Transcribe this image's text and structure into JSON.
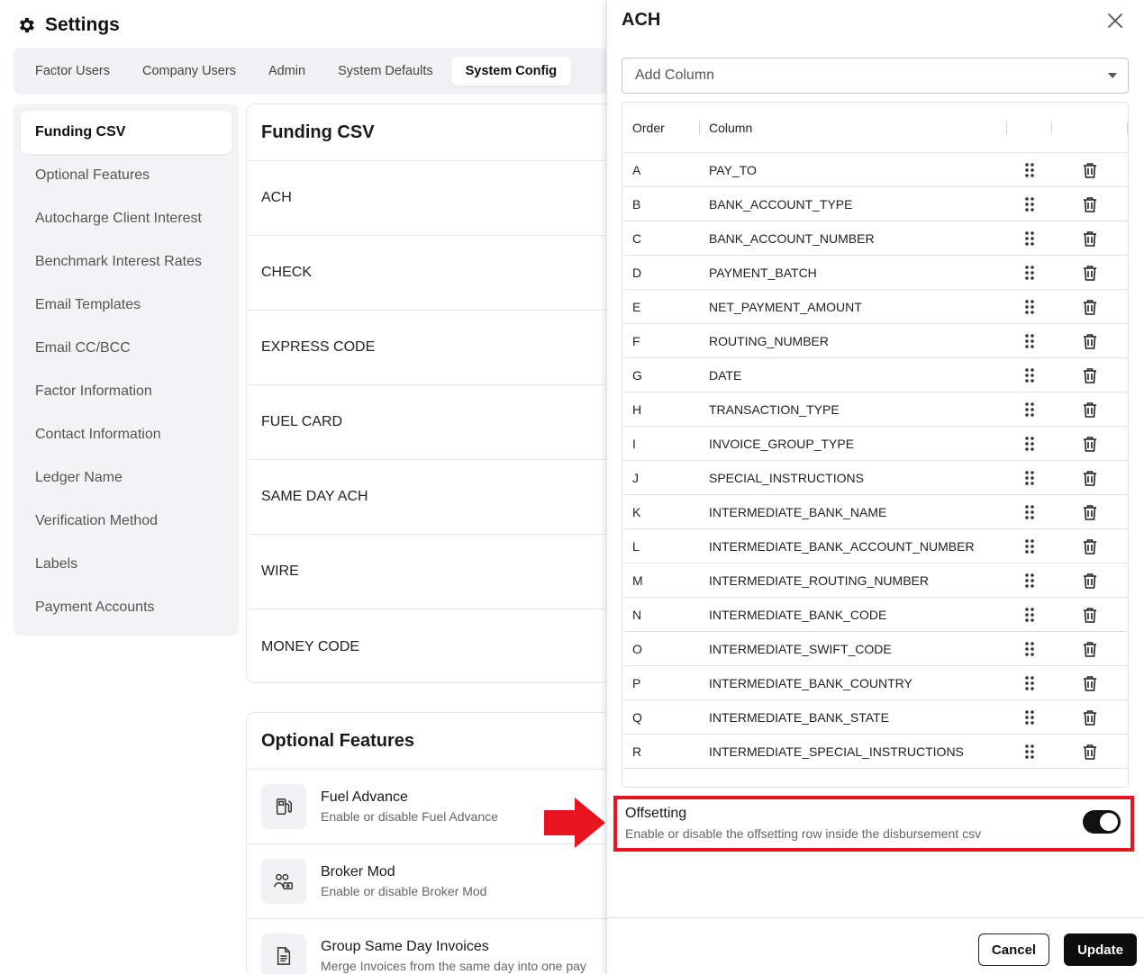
{
  "header": {
    "title": "Settings"
  },
  "tabs": [
    {
      "label": "Factor Users"
    },
    {
      "label": "Company Users"
    },
    {
      "label": "Admin"
    },
    {
      "label": "System Defaults"
    },
    {
      "label": "System Config"
    }
  ],
  "sidebar": {
    "items": [
      {
        "label": "Funding CSV"
      },
      {
        "label": "Optional Features"
      },
      {
        "label": "Autocharge Client Interest"
      },
      {
        "label": "Benchmark Interest Rates"
      },
      {
        "label": "Email Templates"
      },
      {
        "label": "Email CC/BCC"
      },
      {
        "label": "Factor Information"
      },
      {
        "label": "Contact Information"
      },
      {
        "label": "Ledger Name"
      },
      {
        "label": "Verification Method"
      },
      {
        "label": "Labels"
      },
      {
        "label": "Payment Accounts"
      }
    ]
  },
  "funding_csv": {
    "title": "Funding CSV",
    "rows": [
      "ACH",
      "CHECK",
      "EXPRESS CODE",
      "FUEL CARD",
      "SAME DAY ACH",
      "WIRE",
      "MONEY CODE"
    ]
  },
  "optional_features": {
    "title": "Optional Features",
    "items": [
      {
        "name": "Fuel Advance",
        "desc": "Enable or disable Fuel Advance",
        "icon": "fuel-pump-icon"
      },
      {
        "name": "Broker Mod",
        "desc": "Enable or disable Broker Mod",
        "icon": "users-money-icon"
      },
      {
        "name": "Group Same Day Invoices",
        "desc": "Merge Invoices from the same day into one pay",
        "icon": "document-icon"
      }
    ]
  },
  "drawer": {
    "title": "ACH",
    "add_column_placeholder": "Add Column",
    "table": {
      "headers": {
        "order": "Order",
        "column": "Column"
      },
      "rows": [
        {
          "order": "A",
          "column": "PAY_TO"
        },
        {
          "order": "B",
          "column": "BANK_ACCOUNT_TYPE"
        },
        {
          "order": "C",
          "column": "BANK_ACCOUNT_NUMBER"
        },
        {
          "order": "D",
          "column": "PAYMENT_BATCH"
        },
        {
          "order": "E",
          "column": "NET_PAYMENT_AMOUNT"
        },
        {
          "order": "F",
          "column": "ROUTING_NUMBER"
        },
        {
          "order": "G",
          "column": "DATE"
        },
        {
          "order": "H",
          "column": "TRANSACTION_TYPE"
        },
        {
          "order": "I",
          "column": "INVOICE_GROUP_TYPE"
        },
        {
          "order": "J",
          "column": "SPECIAL_INSTRUCTIONS"
        },
        {
          "order": "K",
          "column": "INTERMEDIATE_BANK_NAME"
        },
        {
          "order": "L",
          "column": "INTERMEDIATE_BANK_ACCOUNT_NUMBER"
        },
        {
          "order": "M",
          "column": "INTERMEDIATE_ROUTING_NUMBER"
        },
        {
          "order": "N",
          "column": "INTERMEDIATE_BANK_CODE"
        },
        {
          "order": "O",
          "column": "INTERMEDIATE_SWIFT_CODE"
        },
        {
          "order": "P",
          "column": "INTERMEDIATE_BANK_COUNTRY"
        },
        {
          "order": "Q",
          "column": "INTERMEDIATE_BANK_STATE"
        },
        {
          "order": "R",
          "column": "INTERMEDIATE_SPECIAL_INSTRUCTIONS"
        }
      ]
    },
    "offsetting": {
      "title": "Offsetting",
      "desc": "Enable or disable the offsetting row inside the disbursement csv",
      "enabled": true
    },
    "buttons": {
      "cancel": "Cancel",
      "update": "Update"
    }
  },
  "colors": {
    "accent": "#0d0d0d",
    "highlight": "#e8151f"
  }
}
